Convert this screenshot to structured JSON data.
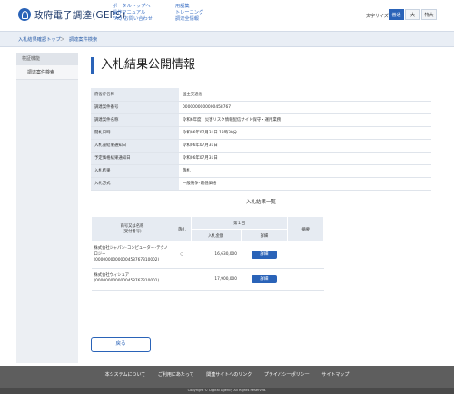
{
  "header": {
    "site_title": "政府電子調達(GEPS)",
    "nav_col1": [
      "ポータルトップへ",
      "操作マニュアル",
      "FAQ･お問い合わせ"
    ],
    "nav_col2": [
      "用語集",
      "トレーニング",
      "調達全情報"
    ],
    "font_size_label": "文字サイズ",
    "font_sizes": [
      "普通",
      "大",
      "特大"
    ]
  },
  "breadcrumb": [
    "入札結果確認トップ",
    "調達案件検索"
  ],
  "sidebar": {
    "head": "検証機能",
    "items": [
      "調達案件検索"
    ]
  },
  "main": {
    "page_title": "入札結果公開情報",
    "info_rows": [
      {
        "label": "府省庁名称",
        "value": "国土交通省"
      },
      {
        "label": "調達案件番号",
        "value": "0000000000000458767"
      },
      {
        "label": "調達案件名称",
        "value": "令和6年度　災害リスク情報配信サイト保守・運用業務"
      },
      {
        "label": "開札日時",
        "value": "令和06年07月31日 13時30分"
      },
      {
        "label": "入札書結果通知日",
        "value": "令和06年07月31日"
      },
      {
        "label": "予定価格結果通知日",
        "value": "令和06年07月31日"
      },
      {
        "label": "入札結果",
        "value": "落札"
      },
      {
        "label": "入札方式",
        "value": "一般競争･最低価格"
      }
    ],
    "results_title": "入札結果一覧",
    "results_table": {
      "col_company": "商号又は名称\n(受付番号)",
      "col_won": "落札",
      "col_round": "第１回",
      "col_amount": "入札金額",
      "col_detail": "詳細",
      "col_note": "摘要",
      "rows": [
        {
          "company": "株式会社ジャパン･コンピューター･テクノロジー",
          "receipt": "(0000000000000458767310002)",
          "won": "○",
          "amount": "16,630,000",
          "detail": "詳細"
        },
        {
          "company": "株式会社ウィシュア",
          "receipt": "(0000000000000458767310001)",
          "won": "",
          "amount": "17,900,000",
          "detail": "詳細"
        }
      ]
    },
    "back_button": "戻る"
  },
  "footer": {
    "links": [
      "本システムについて",
      "ご利用にあたって",
      "関連サイトへのリンク",
      "プライバシーポリシー",
      "サイトマップ"
    ],
    "copyright": "Copyright © Digital Agency All Rights Reserved."
  }
}
